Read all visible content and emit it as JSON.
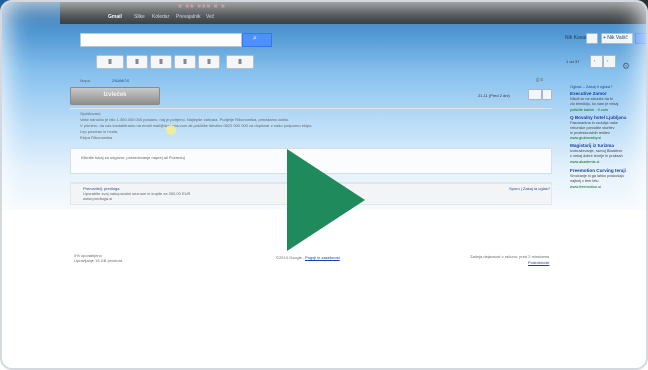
{
  "video": {
    "play_icon": "play-icon",
    "play_color": "#1f8a5b"
  },
  "googlebar": {
    "links": [
      "Gmail",
      "Slike",
      "Koledar",
      "Prevajalnik",
      "Več"
    ],
    "active": "Gmail"
  },
  "search": {
    "button_icon": "search-icon"
  },
  "header_right": {
    "user": "Nik Kovač",
    "share": "+ Nik Vašič",
    "settings_icon": "gear-icon"
  },
  "toolbar": {
    "buttons": [
      "archive",
      "spam",
      "delete",
      "folder",
      "label",
      "more"
    ],
    "counter": "1 od 37",
    "pager_prev": "‹",
    "pager_next": "›"
  },
  "breadcrumb": {
    "prefix": "Mapa",
    "current": "ZNAMOS"
  },
  "message": {
    "action_label": "Izvleček",
    "date": "21.11 (Pred 2 dni)",
    "lines": [
      "Spoštovani,",
      "Vaše naročilo je bilo 1.300.000.000 poslano, naj je potrjeno. Najlepše zahvala, Podjetje Ribonomika, prinašamo darilo.",
      "V primeru, da vas kontaktiramo na email mail@domena.com ali pokličite številko 0622 000 000 za dopisnar z našo podporno ekipo.",
      "Lep pozdrav in hvala,",
      "Ekipa Ribonomika"
    ],
    "reply_hint": "Kliknite tukaj za odgovor, posredovanje naprej ali Posreduj"
  },
  "list_item": {
    "title": "Prenovitelj: predloga",
    "line1": "Uporabite svoj nakupovalni seznam in kupite za 300,00 EUR",
    "line2": "www.predloga.si",
    "tag": "Sporo | Zakaj ta oglas?"
  },
  "footer": {
    "left_1": "0% uporabljeno",
    "left_2": "Upravljanje 15 GB prostora",
    "center": "©2013 Google -",
    "center_link": "Pogoji in zasebnost",
    "right_1": "Zadnja dejavnost v računu: pred 2 minutama",
    "right_2": "Podrobnosti"
  },
  "ads": {
    "header": "Oglasi – Zakaj ti oglasi?",
    "items": [
      {
        "title": "Executive Zamor",
        "text": [
          "Nikoli se ne sklonite da bi",
          "zlo tehnikijo, ko vam je nekaj"
        ],
        "url": "poiščite banke - 9.com"
      },
      {
        "title": "Q Bovalny hotel Ljubljana",
        "text": [
          "Fascinantna in vzdušje naše",
          "vrhunske ponudbe storitev",
          "in profesionalnih rešitev"
        ],
        "url": "www.grobovalny.si"
      },
      {
        "title": "Magistarij iz turizma",
        "text": [
          "Izobraževanje, razvoj Bioaktive",
          "z nekaj dobre teorije in praksah"
        ],
        "url": "www.akademia.si"
      },
      {
        "title": "Freemotion Curving teraji",
        "text": [
          "Smučanje ki ga lahko poskušajo",
          "najbolj v tem letu"
        ],
        "url": "www.freemotion.si"
      }
    ]
  }
}
